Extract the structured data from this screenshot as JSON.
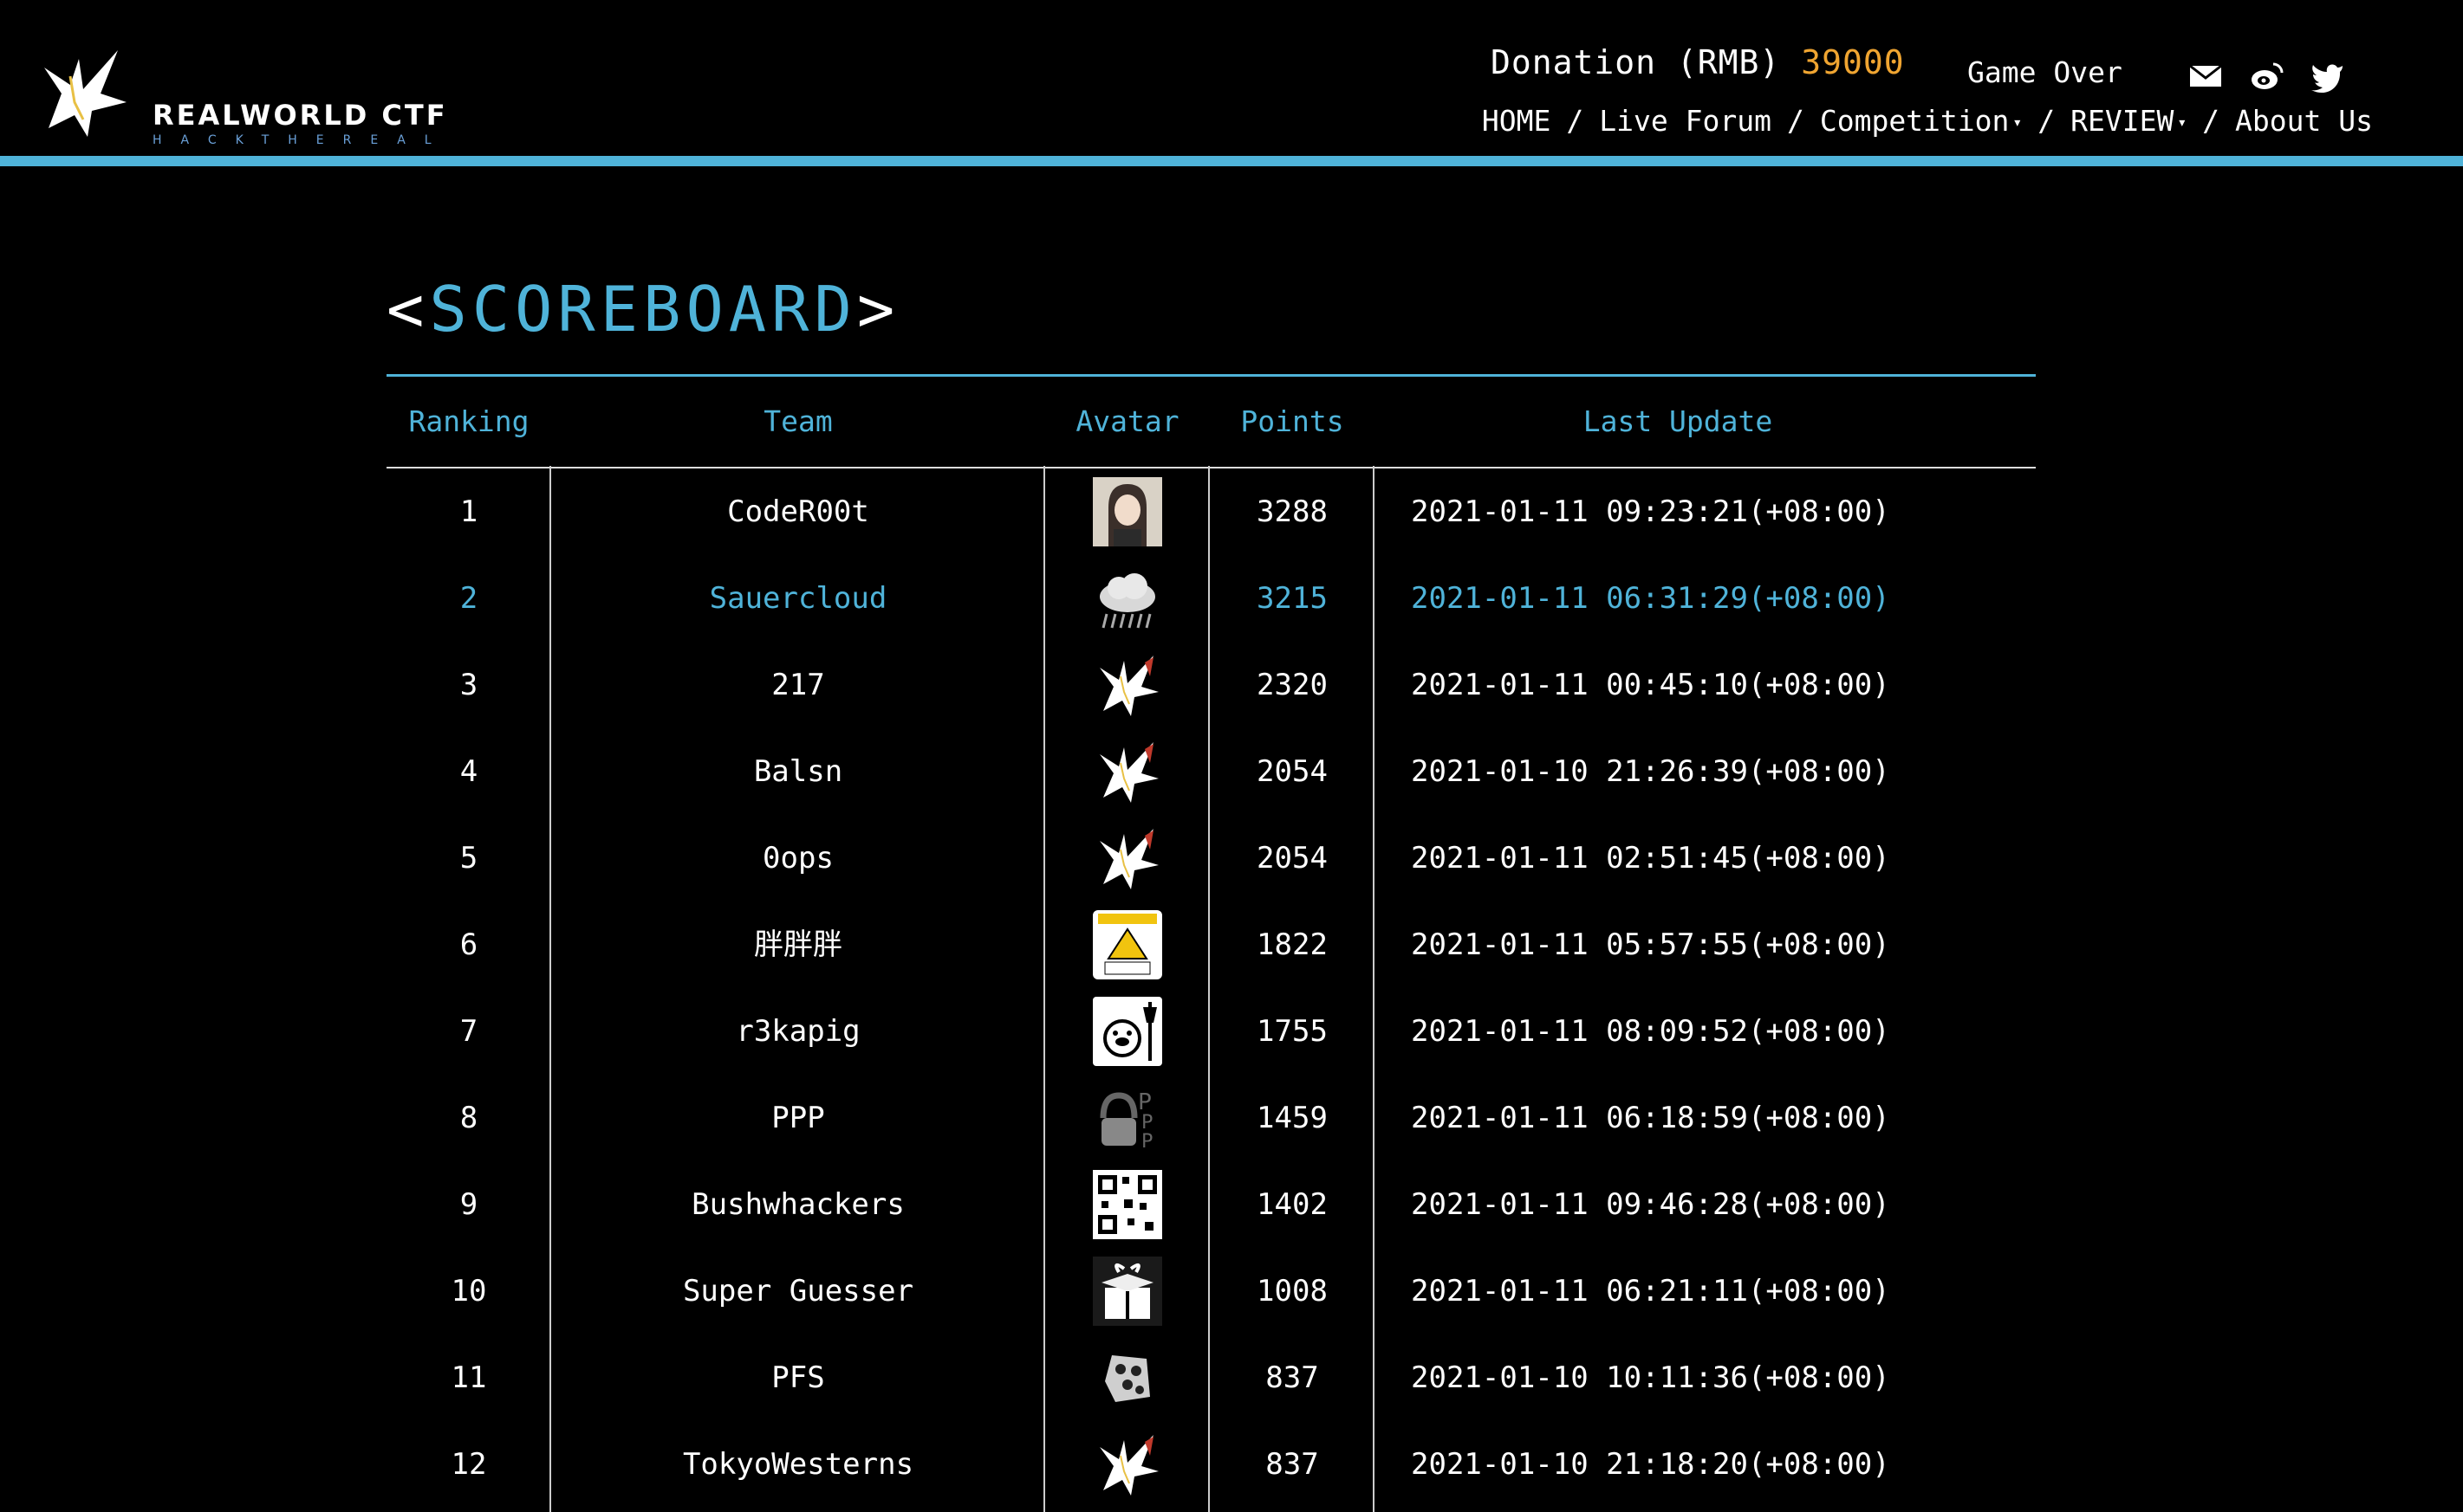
{
  "header": {
    "logo_text": "REALWORLD CTF",
    "logo_sub": "HACKTHEREAL",
    "donation_label": "Donation (RMB)",
    "donation_amount": "39000",
    "status": "Game Over",
    "icons": [
      "mail-icon",
      "weibo-icon",
      "twitter-icon"
    ],
    "nav": [
      {
        "label": "HOME",
        "dropdown": false
      },
      {
        "label": "Live Forum",
        "dropdown": false
      },
      {
        "label": "Competition",
        "dropdown": true
      },
      {
        "label": "REVIEW",
        "dropdown": true
      },
      {
        "label": "About Us",
        "dropdown": false
      }
    ]
  },
  "page": {
    "title_open": "<",
    "title_word": "SCOREBOARD",
    "title_close": ">"
  },
  "table": {
    "headers": {
      "ranking": "Ranking",
      "team": "Team",
      "avatar": "Avatar",
      "points": "Points",
      "last_update": "Last Update"
    },
    "rows": [
      {
        "rank": "1",
        "team": "CodeR00t",
        "avatar": "girl-avatar",
        "points": "3288",
        "updated": "2021-01-11 09:23:21(+08:00)"
      },
      {
        "rank": "2",
        "team": "Sauercloud",
        "avatar": "cloud-avatar",
        "points": "3215",
        "updated": "2021-01-11 06:31:29(+08:00)"
      },
      {
        "rank": "3",
        "team": "217",
        "avatar": "dragon-avatar",
        "points": "2320",
        "updated": "2021-01-11 00:45:10(+08:00)"
      },
      {
        "rank": "4",
        "team": "Balsn",
        "avatar": "dragon-avatar",
        "points": "2054",
        "updated": "2021-01-10 21:26:39(+08:00)"
      },
      {
        "rank": "5",
        "team": "0ops",
        "avatar": "dragon-avatar",
        "points": "2054",
        "updated": "2021-01-11 02:51:45(+08:00)"
      },
      {
        "rank": "6",
        "team": "胖胖胖",
        "avatar": "caution-sign-avatar",
        "points": "1822",
        "updated": "2021-01-11 05:57:55(+08:00)"
      },
      {
        "rank": "7",
        "team": "r3kapig",
        "avatar": "pig-avatar",
        "points": "1755",
        "updated": "2021-01-11 08:09:52(+08:00)"
      },
      {
        "rank": "8",
        "team": "PPP",
        "avatar": "ppp-lock-avatar",
        "points": "1459",
        "updated": "2021-01-11 06:18:59(+08:00)"
      },
      {
        "rank": "9",
        "team": "Bushwhackers",
        "avatar": "qr-code-avatar",
        "points": "1402",
        "updated": "2021-01-11 09:46:28(+08:00)"
      },
      {
        "rank": "10",
        "team": "Super Guesser",
        "avatar": "gift-box-avatar",
        "points": "1008",
        "updated": "2021-01-11 06:21:11(+08:00)"
      },
      {
        "rank": "11",
        "team": "PFS",
        "avatar": "dice-avatar",
        "points": "837",
        "updated": "2021-01-10 10:11:36(+08:00)"
      },
      {
        "rank": "12",
        "team": "TokyoWesterns",
        "avatar": "dragon-avatar",
        "points": "837",
        "updated": "2021-01-10 21:18:20(+08:00)"
      }
    ],
    "highlight_rank": "2"
  },
  "colors": {
    "accent": "#4fb3d9",
    "donation": "#f0a531",
    "background": "#000000"
  }
}
